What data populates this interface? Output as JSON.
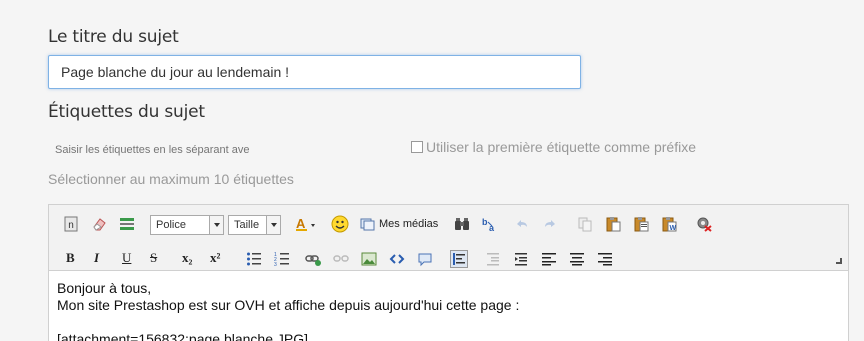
{
  "form": {
    "title_label": "Le titre du sujet",
    "title_value": "Page blanche du jour au lendemain !",
    "tags_label": "Étiquettes du sujet",
    "tags_placeholder": "Saisir les étiquettes en les séparant ave",
    "prefix_label": "Utiliser la première étiquette comme préfixe",
    "hint": "Sélectionner au maximum 10 étiquettes"
  },
  "toolbar": {
    "font_select": "Police",
    "size_select": "Taille",
    "media_label": "Mes médias",
    "bold": "B",
    "italic": "I",
    "underline": "U",
    "strike": "S",
    "subscript": "x₂",
    "superscript": "x²"
  },
  "editor": {
    "lines": [
      "Bonjour à tous,",
      "Mon site Prestashop est sur OVH et affiche depuis aujourd'hui cette page :",
      "",
      "[attachment=156832:page blanche.JPG]"
    ]
  }
}
